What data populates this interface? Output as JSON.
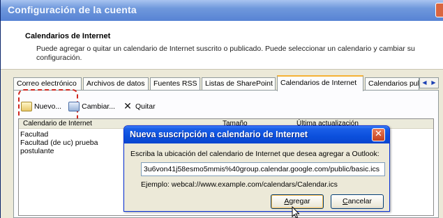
{
  "window": {
    "title": "Configuración de la cuenta"
  },
  "header": {
    "heading": "Calendarios de Internet",
    "description": "Puede agregar o quitar un calendario de Internet suscrito o publicado. Puede seleccionar un calendario y cambiar su configuración."
  },
  "tabs": [
    {
      "label": "Correo electrónico"
    },
    {
      "label": "Archivos de datos"
    },
    {
      "label": "Fuentes RSS"
    },
    {
      "label": "Listas de SharePoint"
    },
    {
      "label": "Calendarios de Internet"
    },
    {
      "label": "Calendarios publi"
    }
  ],
  "toolbar": {
    "new_label": "Nuevo...",
    "change_label": "Cambiar...",
    "remove_label": "Quitar"
  },
  "list": {
    "columns": [
      "Calendario de Internet",
      "Tamaño",
      "Última actualización"
    ],
    "rows": [
      "Facultad",
      "Facultad (de uc) prueba",
      "postulante"
    ]
  },
  "dialog": {
    "title": "Nueva suscripción a calendario de Internet",
    "prompt": "Escriba la ubicación del calendario de Internet que desea agregar a Outlook:",
    "url_value": "3u6von41j58esmo5mmis%40group.calendar.google.com/public/basic.ics",
    "example": "Ejemplo: webcal://www.example.com/calendars/Calendar.ics",
    "add_label_pre": "",
    "add_label_access": "A",
    "add_label_post": "gregar",
    "cancel_label_access": "C",
    "cancel_label_post": "ancelar"
  },
  "colors": {
    "dialog_title": "#0b4fdc",
    "active_tab_accent": "#f5b134",
    "highlight": "#d0261e"
  }
}
